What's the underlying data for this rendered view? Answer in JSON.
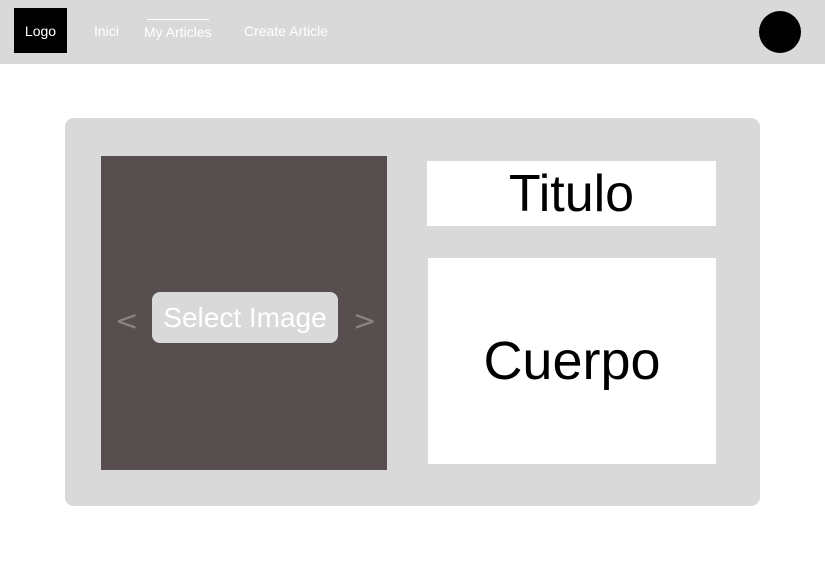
{
  "header": {
    "logo_label": "Logo",
    "nav": {
      "inici": "Inici",
      "my_articles": "My Articles",
      "create_article": "Create Article"
    },
    "active_nav": "My Articles"
  },
  "editor": {
    "image_panel": {
      "select_label": "Select Image",
      "prev_icon": "chevron-left-icon",
      "next_icon": "chevron-right-icon",
      "prev_glyph": "<",
      "next_glyph": ">"
    },
    "title_field": {
      "placeholder": "Titulo"
    },
    "body_field": {
      "placeholder": "Cuerpo"
    }
  },
  "colors": {
    "header_bg": "#d9d9d9",
    "card_bg": "#d9d9d9",
    "image_panel_bg": "#574f4f",
    "logo_bg": "#000000",
    "avatar": "#000000"
  }
}
